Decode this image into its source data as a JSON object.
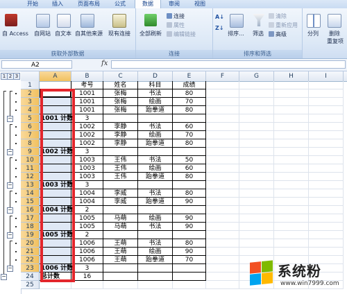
{
  "tabs": [
    "开始",
    "插入",
    "页面布局",
    "公式",
    "数据",
    "审阅",
    "视图"
  ],
  "active_tab": "数据",
  "ribbon": {
    "group_external": {
      "title": "获取外部数据",
      "buttons": [
        "自 Access",
        "自网站",
        "自文本",
        "自其他来源",
        "现有连接"
      ]
    },
    "group_connections": {
      "title": "连接",
      "refresh": "全部刷新",
      "items": [
        "连接",
        "属性",
        "编辑链接"
      ]
    },
    "group_sort": {
      "title": "排序和筛选",
      "sort": "排序...",
      "filter": "筛选",
      "items": [
        "清除",
        "重新应用",
        "高级"
      ]
    },
    "group_tools": {
      "split": "分列",
      "remove_dup": "删除",
      "remove_dup2": "重复项"
    }
  },
  "formula_bar": {
    "name_box": "A2",
    "fx": "fx",
    "content": ""
  },
  "outline_levels": [
    "1",
    "2",
    "3"
  ],
  "columns": [
    "A",
    "B",
    "C",
    "D",
    "E",
    "F",
    "G",
    "H",
    "I"
  ],
  "rows": [
    {
      "n": "1",
      "a": "",
      "b": "考号",
      "c": "姓名",
      "d": "科目",
      "e": "成绩"
    },
    {
      "n": "2",
      "a": "",
      "b": "1001",
      "c": "张梅",
      "d": "书法",
      "e": "80"
    },
    {
      "n": "3",
      "a": "",
      "b": "1001",
      "c": "张梅",
      "d": "绘画",
      "e": "70"
    },
    {
      "n": "4",
      "a": "",
      "b": "1001",
      "c": "张梅",
      "d": "跆拳道",
      "e": "80"
    },
    {
      "n": "5",
      "a": "1001 计数",
      "b": "3",
      "c": "",
      "d": "",
      "e": ""
    },
    {
      "n": "6",
      "a": "",
      "b": "1002",
      "c": "李静",
      "d": "书法",
      "e": "60"
    },
    {
      "n": "7",
      "a": "",
      "b": "1002",
      "c": "李静",
      "d": "绘画",
      "e": "70"
    },
    {
      "n": "8",
      "a": "",
      "b": "1002",
      "c": "李静",
      "d": "跆拳道",
      "e": "80"
    },
    {
      "n": "9",
      "a": "1002 计数",
      "b": "3",
      "c": "",
      "d": "",
      "e": ""
    },
    {
      "n": "10",
      "a": "",
      "b": "1003",
      "c": "王伟",
      "d": "书法",
      "e": "50"
    },
    {
      "n": "11",
      "a": "",
      "b": "1003",
      "c": "王伟",
      "d": "绘画",
      "e": "60"
    },
    {
      "n": "12",
      "a": "",
      "b": "1003",
      "c": "王伟",
      "d": "跆拳道",
      "e": "80"
    },
    {
      "n": "13",
      "a": "1003 计数",
      "b": "3",
      "c": "",
      "d": "",
      "e": ""
    },
    {
      "n": "14",
      "a": "",
      "b": "1004",
      "c": "李威",
      "d": "书法",
      "e": "80"
    },
    {
      "n": "15",
      "a": "",
      "b": "1004",
      "c": "李威",
      "d": "跆拳道",
      "e": "90"
    },
    {
      "n": "16",
      "a": "1004 计数",
      "b": "2",
      "c": "",
      "d": "",
      "e": ""
    },
    {
      "n": "17",
      "a": "",
      "b": "1005",
      "c": "马萌",
      "d": "绘画",
      "e": "90"
    },
    {
      "n": "18",
      "a": "",
      "b": "1005",
      "c": "马萌",
      "d": "书法",
      "e": "90"
    },
    {
      "n": "19",
      "a": "1005 计数",
      "b": "2",
      "c": "",
      "d": "",
      "e": ""
    },
    {
      "n": "20",
      "a": "",
      "b": "1006",
      "c": "王萌",
      "d": "书法",
      "e": "80"
    },
    {
      "n": "21",
      "a": "",
      "b": "1006",
      "c": "王萌",
      "d": "绘画",
      "e": "90"
    },
    {
      "n": "22",
      "a": "",
      "b": "1006",
      "c": "王萌",
      "d": "跆拳道",
      "e": "70"
    },
    {
      "n": "23",
      "a": "1006 计数",
      "b": "3",
      "c": "",
      "d": "",
      "e": ""
    },
    {
      "n": "24",
      "a": "总计数",
      "b": "16",
      "c": "",
      "d": "",
      "e": ""
    },
    {
      "n": "25",
      "a": "",
      "b": "",
      "c": "",
      "d": "",
      "e": ""
    }
  ],
  "watermark": {
    "text": "系统粉",
    "url": "www.win7999.com",
    "colors": [
      "#f25022",
      "#7fba00",
      "#00a4ef",
      "#ffb900"
    ]
  }
}
